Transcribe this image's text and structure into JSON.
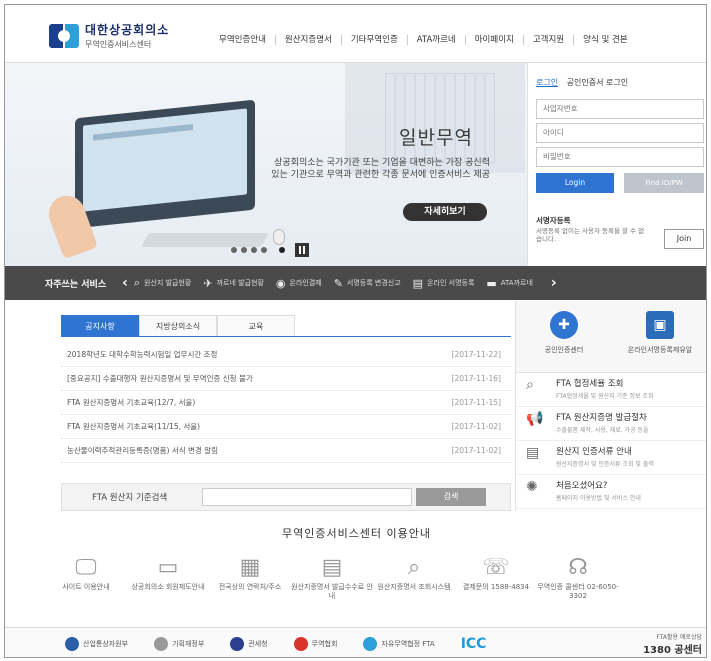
{
  "header": {
    "logo_title": "대한상공회의소",
    "logo_subtitle": "무역인증서비스센터",
    "nav": [
      "무역인증안내",
      "원산지증명서",
      "기타무역인증",
      "ATA까르네",
      "마이페이지",
      "고객지원",
      "양식 및 견본"
    ]
  },
  "hero": {
    "title": "일반무역",
    "description": "상공회의소는 국가기관 또는 기업을 대변하는 가장 공신력 있는 기관으로 무역과 관련한 각종 문서에 인증서비스 제공",
    "button": "자세히보기"
  },
  "login": {
    "tab_active": "로그인",
    "tab_cert": "공인인증서 로그인",
    "field_biz": "사업자번호",
    "field_id": "아이디",
    "field_pw": "비밀번호",
    "btn_login": "Login",
    "btn_find": "Find ID/PW",
    "join_title": "서명자등록",
    "join_desc": "서명등록 없이는 사용자 등록을 할 수 없습니다.",
    "btn_join": "Join"
  },
  "quickbar": {
    "title": "자주쓰는 서비스",
    "items": [
      {
        "icon": "search-icon",
        "glyph": "⌕",
        "label": "원산지 발급현황"
      },
      {
        "icon": "plane-icon",
        "glyph": "✈",
        "label": "까르네 발급현황"
      },
      {
        "icon": "online-icon",
        "glyph": "◉",
        "label": "온라인결제"
      },
      {
        "icon": "pen-icon",
        "glyph": "✎",
        "label": "서명등록 변경신고"
      },
      {
        "icon": "doc-icon",
        "glyph": "▤",
        "label": "온라인 서명등록"
      },
      {
        "icon": "ata-icon",
        "glyph": "▬",
        "label": "ATA까르네"
      }
    ]
  },
  "notice": {
    "tabs": [
      "공지사항",
      "지방상의소식",
      "교육"
    ],
    "items": [
      {
        "title": "2018학년도 대학수학능력시험일 업무시간 조정",
        "date": "[2017-11-22]"
      },
      {
        "title": "[중요공지] 수출대행자 원산지증명서 및 무역인증 신청 불가",
        "date": "[2017-11-16]"
      },
      {
        "title": "FTA 원산지증명서 기초교육(12/7, 서울)",
        "date": "[2017-11-15]"
      },
      {
        "title": "FTA 원산지증명서 기초교육(11/15, 서울)",
        "date": "[2017-11-02]"
      },
      {
        "title": "농산물이력추적관리등록증(명품) 서식 변경 알림",
        "date": "[2017-11-02]"
      }
    ]
  },
  "fta_search": {
    "label": "FTA 원산지 기준검색",
    "button": "검색"
  },
  "right_panel": {
    "tiles": [
      "공인인증센터",
      "온라인서명등록제유알"
    ],
    "links": [
      {
        "title": "FTA 협정세율 조회",
        "sub": "FTA협정세율 및 원산지 기준 정보 조회"
      },
      {
        "title": "FTA 원산지증명 발급절차",
        "sub": "수출물품 제작, 사용, 재료, 가공 등을"
      },
      {
        "title": "원산지 인증서류 안내",
        "sub": "원산지증명서 및 인증서류 조회 및 출력"
      },
      {
        "title": "처음오셨어요?",
        "sub": "홈페이지 이용방법 및 서비스 안내"
      }
    ]
  },
  "guide": {
    "title": "무역인증서비스센터 이용안내",
    "items": [
      {
        "label": "사이트 이용안내",
        "glyph": "🖵"
      },
      {
        "label": "상공회의소 회원제도안내",
        "glyph": "▭"
      },
      {
        "label": "전국상의 연락처/주소",
        "glyph": "▦"
      },
      {
        "label": "원산지증명서 발급수수료 안내",
        "glyph": "▤"
      },
      {
        "label": "원산지증명서 조회시스템",
        "glyph": "⌕"
      },
      {
        "label": "결제문의 1588-4834",
        "glyph": "☏"
      },
      {
        "label": "무역인증 콜센터 02-6050-3302",
        "glyph": "☊"
      }
    ]
  },
  "footer": {
    "logos": [
      "산업통상자원부",
      "기획재정부",
      "관세청",
      "무역협회",
      "자유무역협정 FTA",
      "ICC"
    ],
    "phone_label": "FTA활용 애로상담",
    "phone": "1380 공센터"
  }
}
